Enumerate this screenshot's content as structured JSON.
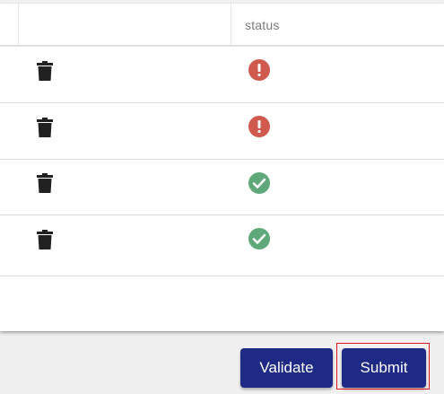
{
  "table": {
    "columns": [
      {
        "label": ""
      },
      {
        "label": ""
      },
      {
        "label": "status"
      }
    ],
    "rows": [
      {
        "action_icon": "trash-icon",
        "status": "error",
        "status_icon": "exclamation-circle-icon"
      },
      {
        "action_icon": "trash-icon",
        "status": "error",
        "status_icon": "exclamation-circle-icon"
      },
      {
        "action_icon": "trash-icon",
        "status": "success",
        "status_icon": "check-circle-icon"
      },
      {
        "action_icon": "trash-icon",
        "status": "success",
        "status_icon": "check-circle-icon"
      }
    ]
  },
  "actions": {
    "validate_label": "Validate",
    "submit_label": "Submit"
  },
  "colors": {
    "primary_button": "#1e2a85",
    "error_status": "#d05a4e",
    "success_status": "#5fa87a",
    "trash_icon": "#212121",
    "highlight": "#e0141e"
  }
}
